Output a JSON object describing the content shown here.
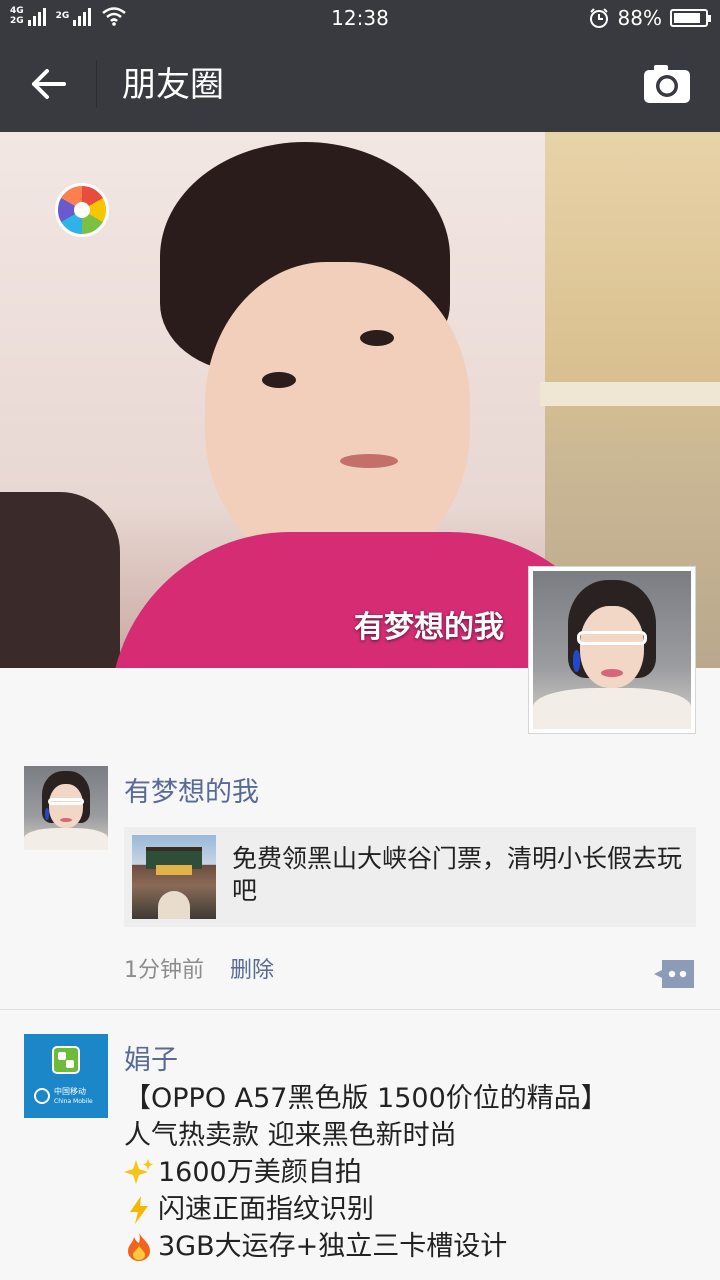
{
  "status_bar": {
    "network_top": "4G",
    "network_bottom": "2G",
    "network_secondary": "2G",
    "time": "12:38",
    "battery_percent": "88%",
    "battery_level": 0.88
  },
  "title_bar": {
    "title": "朋友圈",
    "back_icon": "arrow-left-icon",
    "camera_icon": "camera-icon"
  },
  "cover": {
    "user_name": "有梦想的我",
    "camera_icon": "camera-aperture-icon"
  },
  "posts": [
    {
      "author": "有梦想的我",
      "link": {
        "text": "免费领黑山大峡谷门票，清明小长假去玩吧"
      },
      "time": "1分钟前",
      "delete_label": "删除",
      "comment_icon": "comment-dots-icon"
    },
    {
      "author": "娟子",
      "avatar_logo_cn": "中国移动",
      "avatar_logo_en": "China Mobile",
      "lines": [
        {
          "emoji": "",
          "text": "【OPPO A57黑色版 1500价位的精品】"
        },
        {
          "emoji": "",
          "text": "人气热卖款 迎来黑色新时尚"
        },
        {
          "emoji": "sparkles-icon",
          "text": "1600万美颜自拍"
        },
        {
          "emoji": "lightning-icon",
          "text": "闪速正面指纹识别"
        },
        {
          "emoji": "fire-icon",
          "text": "3GB大运存+独立三卡槽设计"
        }
      ]
    }
  ],
  "colors": {
    "header_bg": "#393a3f",
    "link_blue": "#576b95",
    "page_bg": "#f7f7f7"
  }
}
